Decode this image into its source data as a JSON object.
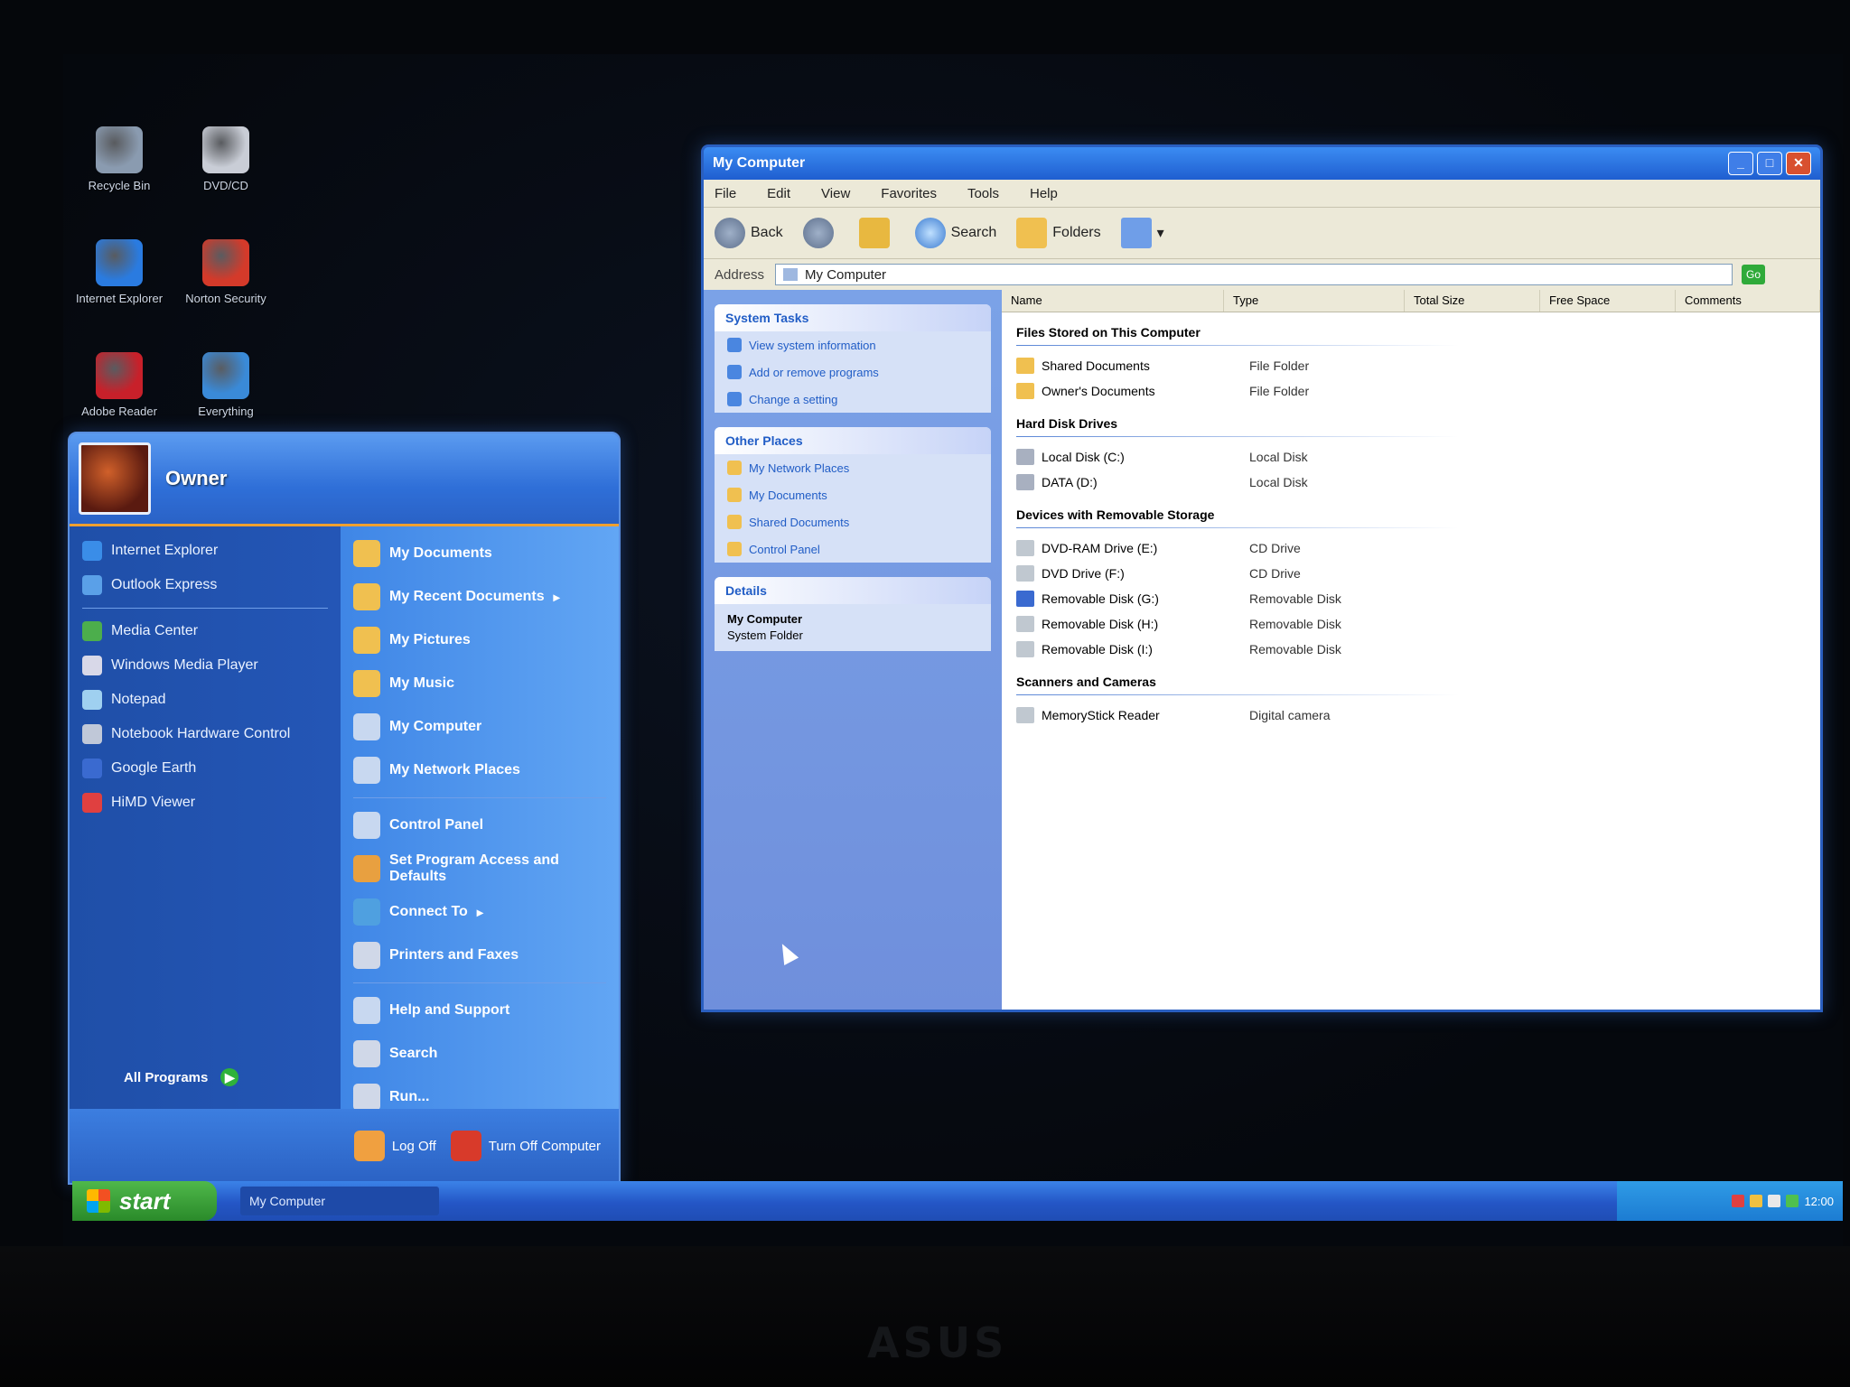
{
  "desktop": {
    "icons": [
      {
        "label": "Recycle Bin",
        "color": "#8a9bb0"
      },
      {
        "label": "DVD/CD",
        "color": "#c9cdd6"
      },
      {
        "label": "Internet Explorer",
        "color": "#2a7be0"
      },
      {
        "label": "Norton Security",
        "color": "#d43a2a"
      },
      {
        "label": "Adobe Reader",
        "color": "#c8202a"
      },
      {
        "label": "Everything",
        "color": "#3a8ad8"
      }
    ]
  },
  "start_menu": {
    "user_name": "Owner",
    "left_items": [
      {
        "label": "Internet Explorer",
        "icon": "ie-icon",
        "color": "#3a8de8"
      },
      {
        "label": "Outlook Express",
        "icon": "mail-icon",
        "color": "#5aa0e8"
      }
    ],
    "left_recent": [
      {
        "label": "Media Center",
        "icon": "media-center-icon",
        "color": "#4cae4c"
      },
      {
        "label": "Windows Media Player",
        "icon": "media-player-icon",
        "color": "#d8d8e8"
      },
      {
        "label": "Notepad",
        "icon": "notepad-icon",
        "color": "#9fd0f0"
      },
      {
        "label": "Notebook Hardware Control",
        "icon": "hardware-control-icon",
        "color": "#c0c8d8"
      },
      {
        "label": "Google Earth",
        "icon": "globe-icon",
        "color": "#3a6ad0"
      },
      {
        "label": "HiMD Viewer",
        "icon": "viewer-icon",
        "color": "#e04040"
      }
    ],
    "all_programs_label": "All Programs",
    "right_items": [
      {
        "label": "My Documents",
        "icon": "folder-icon",
        "color": "#f0c050",
        "arrow": ""
      },
      {
        "label": "My Recent Documents",
        "icon": "recent-docs-icon",
        "color": "#f0c050",
        "arrow": "▸"
      },
      {
        "label": "My Pictures",
        "icon": "pictures-icon",
        "color": "#f0c050",
        "arrow": ""
      },
      {
        "label": "My Music",
        "icon": "music-icon",
        "color": "#f0c050",
        "arrow": ""
      },
      {
        "label": "My Computer",
        "icon": "computer-icon",
        "color": "#c8d8f0",
        "arrow": ""
      },
      {
        "label": "My Network Places",
        "icon": "network-icon",
        "color": "#c8d8f0",
        "arrow": ""
      }
    ],
    "right_items2": [
      {
        "label": "Control Panel",
        "icon": "control-panel-icon",
        "color": "#c8d8f0",
        "arrow": ""
      },
      {
        "label": "Set Program Access and Defaults",
        "icon": "defaults-icon",
        "color": "#e8a040",
        "arrow": ""
      },
      {
        "label": "Connect To",
        "icon": "connect-icon",
        "color": "#4fa0e0",
        "arrow": "▸"
      },
      {
        "label": "Printers and Faxes",
        "icon": "printer-icon",
        "color": "#d0d8e8",
        "arrow": ""
      }
    ],
    "right_items3": [
      {
        "label": "Help and Support",
        "icon": "help-icon",
        "color": "#c8d8f0",
        "arrow": ""
      },
      {
        "label": "Search",
        "icon": "search-icon",
        "color": "#d0d8e8",
        "arrow": ""
      },
      {
        "label": "Run...",
        "icon": "run-icon",
        "color": "#d0d8e8",
        "arrow": ""
      }
    ],
    "footer": {
      "logoff_label": "Log Off",
      "turnoff_label": "Turn Off Computer",
      "logoff_color": "#f0a040",
      "turnoff_color": "#d83a2a"
    }
  },
  "taskbar": {
    "start_label": "start",
    "task_item_label": "My Computer",
    "clock": "12:00"
  },
  "explorer": {
    "title": "My Computer",
    "menu": [
      "File",
      "Edit",
      "View",
      "Favorites",
      "Tools",
      "Help"
    ],
    "toolbar": {
      "back_label": "Back",
      "search_label": "Search",
      "folders_label": "Folders"
    },
    "address_label": "Address",
    "address_value": "My Computer",
    "go_label": "Go",
    "task_pane": {
      "system_tasks_title": "System Tasks",
      "system_tasks": [
        "View system information",
        "Add or remove programs",
        "Change a setting"
      ],
      "other_places_title": "Other Places",
      "other_places": [
        "My Network Places",
        "My Documents",
        "Shared Documents",
        "Control Panel"
      ],
      "details_title": "Details",
      "details_name": "My Computer",
      "details_type": "System Folder"
    },
    "columns": [
      "Name",
      "Type",
      "Total Size",
      "Free Space",
      "Comments"
    ],
    "groups": [
      {
        "title": "Files Stored on This Computer",
        "rows": [
          {
            "name": "Shared Documents",
            "type": "File Folder",
            "total": "",
            "free": "",
            "icon_color": "#f0c050"
          },
          {
            "name": "Owner's Documents",
            "type": "File Folder",
            "total": "",
            "free": "",
            "icon_color": "#f0c050"
          }
        ]
      },
      {
        "title": "Hard Disk Drives",
        "rows": [
          {
            "name": "Local Disk (C:)",
            "type": "Local Disk",
            "total": "",
            "free": "",
            "icon_color": "#a8b0c0"
          },
          {
            "name": "DATA (D:)",
            "type": "Local Disk",
            "total": "",
            "free": "",
            "icon_color": "#a8b0c0"
          }
        ]
      },
      {
        "title": "Devices with Removable Storage",
        "rows": [
          {
            "name": "DVD-RAM Drive (E:)",
            "type": "CD Drive",
            "total": "",
            "free": "",
            "icon_color": "#c0c8d0"
          },
          {
            "name": "DVD Drive (F:)",
            "type": "CD Drive",
            "total": "",
            "free": "",
            "icon_color": "#c0c8d0"
          },
          {
            "name": "Removable Disk (G:)",
            "type": "Removable Disk",
            "total": "",
            "free": "",
            "icon_color": "#3a6ad0"
          },
          {
            "name": "Removable Disk (H:)",
            "type": "Removable Disk",
            "total": "",
            "free": "",
            "icon_color": "#c0c8d0"
          },
          {
            "name": "Removable Disk (I:)",
            "type": "Removable Disk",
            "total": "",
            "free": "",
            "icon_color": "#c0c8d0"
          }
        ]
      },
      {
        "title": "Scanners and Cameras",
        "rows": [
          {
            "name": "MemoryStick Reader",
            "type": "Digital camera",
            "total": "",
            "free": "",
            "icon_color": "#c0c8d0"
          }
        ]
      }
    ]
  },
  "brand": "ASUS"
}
